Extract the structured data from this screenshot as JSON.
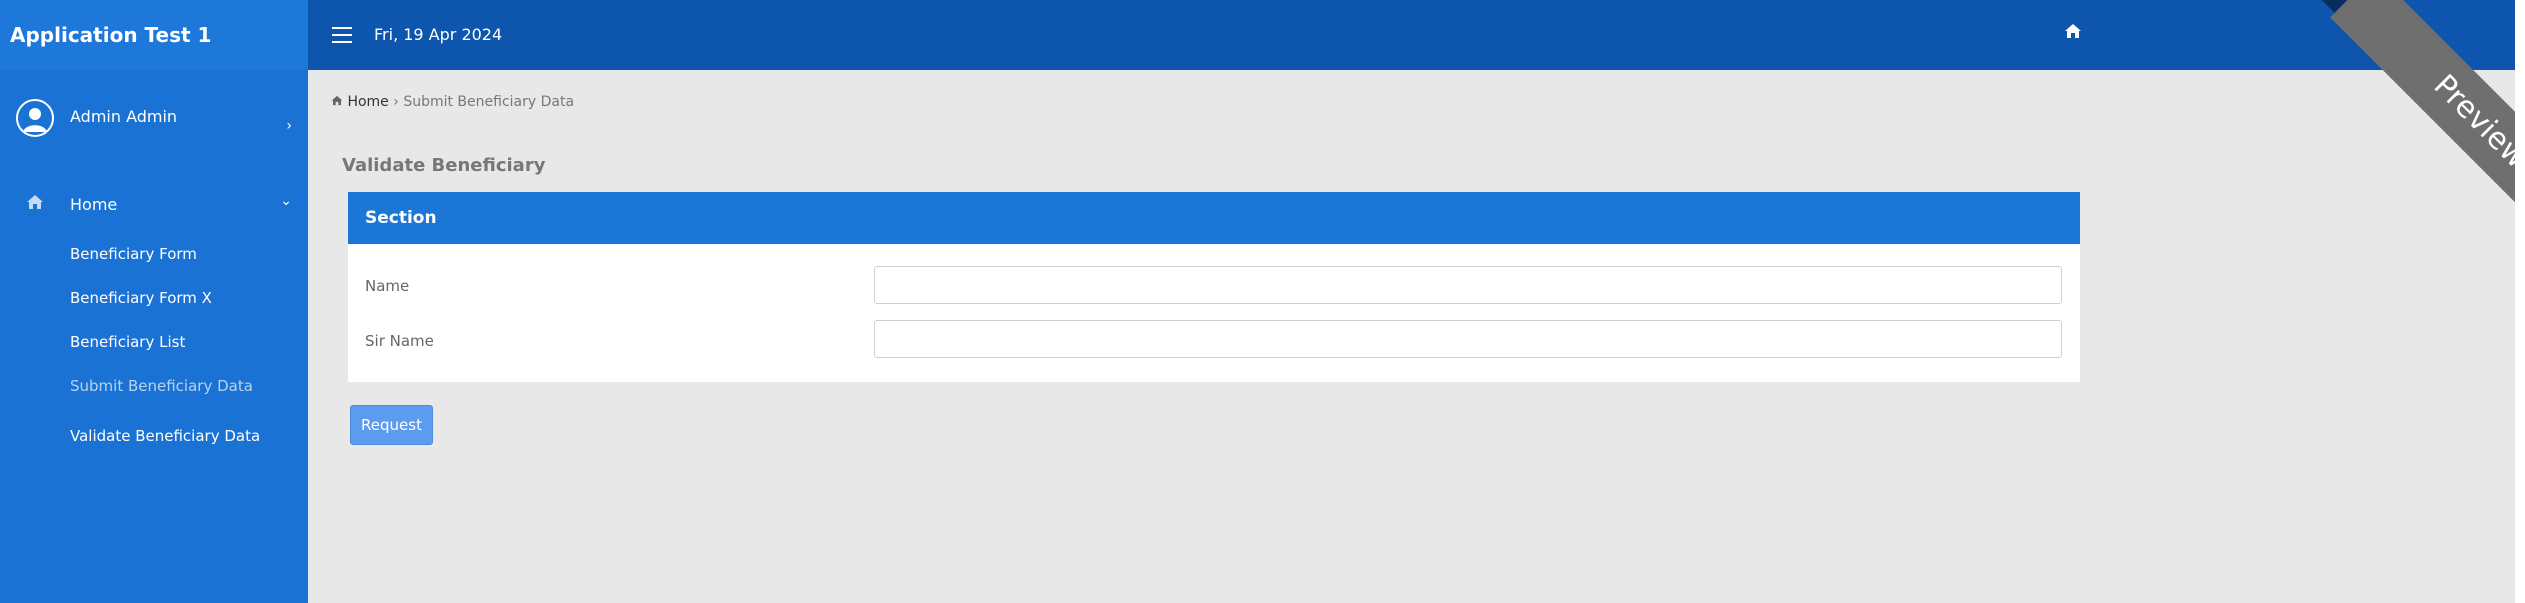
{
  "app": {
    "title": "Application Test 1"
  },
  "user": {
    "name": "Admin Admin"
  },
  "sidebar": {
    "home_label": "Home",
    "items": [
      {
        "label": "Beneficiary Form"
      },
      {
        "label": "Beneficiary Form X"
      },
      {
        "label": "Beneficiary List"
      },
      {
        "label": "Submit Beneficiary Data",
        "active": true
      },
      {
        "label": "Validate Beneficiary Data"
      }
    ]
  },
  "topbar": {
    "date": "Fri, 19 Apr 2024"
  },
  "ribbon": {
    "text": "Preview"
  },
  "breadcrumb": {
    "home": "Home",
    "separator": "›",
    "current": "Submit Beneficiary Data"
  },
  "page": {
    "title": "Validate Beneficiary"
  },
  "section": {
    "title": "Section",
    "fields": [
      {
        "label": "Name",
        "value": ""
      },
      {
        "label": "Sir Name",
        "value": ""
      }
    ]
  },
  "actions": {
    "request_label": "Request"
  },
  "colors": {
    "sidebar": "#1a72d4",
    "topbar": "#0e55ad",
    "panel_header": "#1b76d6",
    "button": "#5c9cf0",
    "ribbon": "#6f6f6f"
  }
}
